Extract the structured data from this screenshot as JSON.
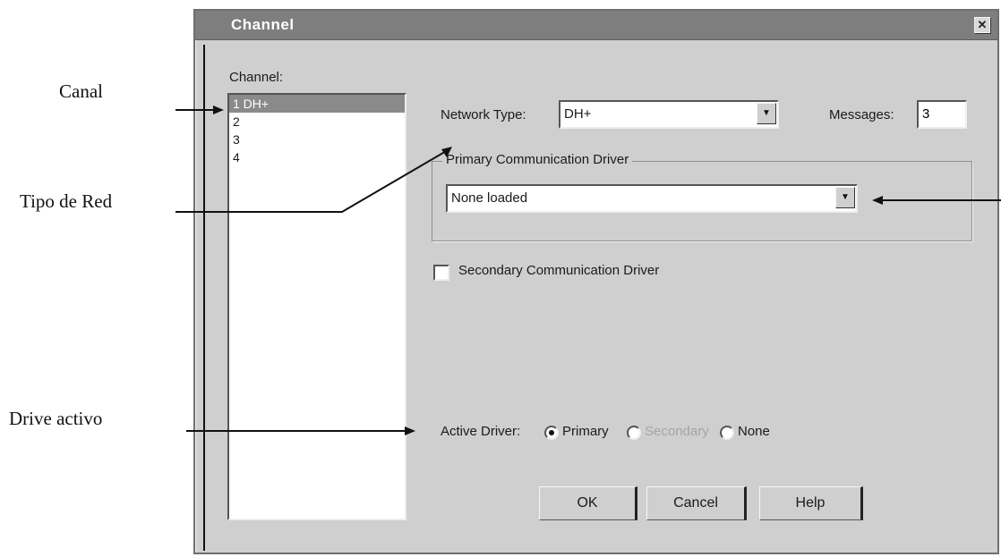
{
  "annotations": {
    "canal": "Canal",
    "tipo_de_red": "Tipo de Red",
    "drive_activo": "Drive activo"
  },
  "dialog": {
    "title": "Channel",
    "close_icon": "close-icon",
    "channel_label": "Channel:",
    "channels": [
      "1  DH+",
      "2",
      "3",
      "4"
    ],
    "selected_channel": "1  DH+",
    "network_type_label": "Network Type:",
    "network_type_value": "DH+",
    "messages_label": "Messages:",
    "messages_value": "3",
    "primary_group_label": "Primary Communication Driver",
    "primary_driver_value": "None  loaded",
    "secondary_checkbox_label": "Secondary Communication Driver",
    "secondary_checked": false,
    "active_driver_label": "Active Driver:",
    "active_options": [
      "Primary",
      "Secondary",
      "None"
    ],
    "active_selected": "Primary",
    "buttons": {
      "ok": "OK",
      "cancel": "Cancel",
      "help": "Help"
    }
  }
}
